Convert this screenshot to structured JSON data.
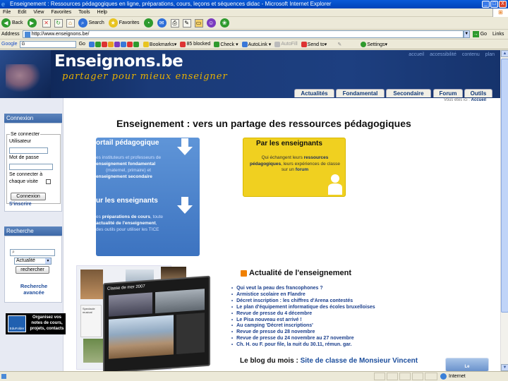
{
  "window": {
    "title": "Enseignement : Ressources pédagogiques en ligne, préparations, cours, leçons et séquences didac - Microsoft Internet Explorer",
    "controls": [
      "_",
      "□",
      "X"
    ]
  },
  "menu": [
    "File",
    "Edit",
    "View",
    "Favorites",
    "Tools",
    "Help"
  ],
  "toolbar": {
    "back": "Back",
    "search": "Search",
    "favorites": "Favorites"
  },
  "address": {
    "label": "Address",
    "url": "http://www.enseignons.be/",
    "go": "Go",
    "links": "Links"
  },
  "googlebar": {
    "logo": "Google",
    "search_value": "G",
    "go": "Go",
    "items": [
      "Bookmarks▾",
      "85 blocked",
      "Check ▾",
      "AutoLink ▾",
      "AutoFill",
      "Send to▾",
      "Settings▾"
    ]
  },
  "site": {
    "logo": "Enseignons.be",
    "tagline": "partager pour mieux enseigner",
    "toplinks": [
      "accueil",
      "accessibilité",
      "contenu",
      "plan"
    ],
    "tabs": [
      "Actualités",
      "Fondamental",
      "Secondaire",
      "Forum",
      "Outils"
    ],
    "breadcrumb_label": "Vous êtes ici :",
    "breadcrumb_current": "Accueil"
  },
  "sidebar": {
    "connexion_title": "Connexion",
    "login_legend": "Se connecter",
    "user_label": "Utilisateur",
    "password_label": "Mot de passe",
    "remember_label": "Se connecter à chaque visite",
    "login_button": "Connexion",
    "signup": "S'inscrire",
    "search_title": "Recherche",
    "search_select": "Actualité",
    "search_button": "rechercher",
    "advanced": "Recherche avancée",
    "promo": "Organisez vos notes de cours, projets, contacts",
    "promo_label": "EduFolder"
  },
  "main": {
    "title": "Enseignement : vers un partage des ressources pédagogiques",
    "portal": {
      "heading": "ortail pédagogique",
      "text_a": "es instituteurs et professeurs de",
      "text_b": "enseignement fondamental",
      "text_c": "(maternel, primaire) et",
      "text_d": "enseignement secondaire"
    },
    "teachers_for": {
      "heading": "ur les enseignants",
      "text_a": "es",
      "text_b": "préparations de cours",
      "text_c": ", toute",
      "text_d": "actualité de l'enseignement",
      "text_e": ",",
      "text_f": "des outils pour utiliser les TICE"
    },
    "teachers_by": {
      "heading": "Par les enseignants",
      "text_a": "Qui échangent leurs",
      "text_b": "ressources pédagogiques",
      "text_c": ", leurs expériences de classe sur un",
      "text_d": "forum"
    },
    "collage_caption": "Classe de mer 2007",
    "collage_label": "Spectacle musical",
    "news_title": "Actualité de l'enseignement",
    "news": [
      "Qui veut la peau des francophones ?",
      "Armistice scolaire en Flandre",
      "Décret inscription : les chiffres d'Arena contestés",
      "Le plan d'équipement informatique des écoles bruxelloises",
      "Revue de presse du 4 décembre",
      "Le Pisa nouveau est arrivé !",
      "Au camping 'Décret inscriptions'",
      "Revue de presse du 28 novembre",
      "Revue de presse du 24 novembre au 27 novembre",
      "Ch. H. ou F. pour file, la nuit du 30.11, rémun. gar."
    ],
    "blog_label": "Le blog du mois :",
    "blog_link": "Site de classe de Monsieur Vincent",
    "blog_thumb": "Le"
  },
  "status": {
    "zone": "Internet"
  },
  "colors": {
    "header_bg": "#1a3a78",
    "tagline": "#e8b000",
    "panel_blue": "#4f86d0",
    "panel_yellow": "#f0d020",
    "link": "#1b3f8c"
  }
}
